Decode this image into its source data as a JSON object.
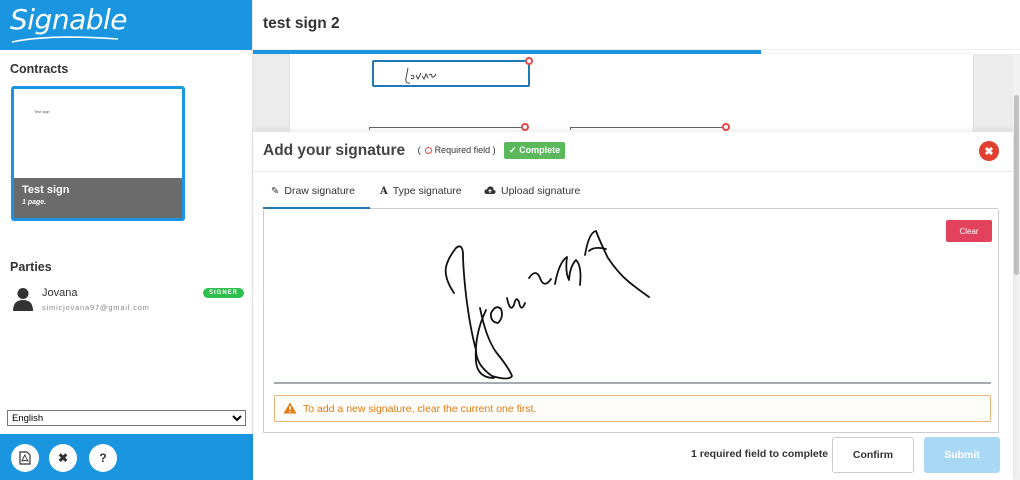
{
  "brand": {
    "name": "Signable"
  },
  "sidebar": {
    "contracts_title": "Contracts",
    "contract": {
      "thumb_text": "Test sign",
      "name": "Test sign",
      "pages": "1 page."
    },
    "parties_title": "Parties",
    "party": {
      "name": "Jovana",
      "email": "simicjovana97@gmail.com",
      "role": "SIGNER"
    },
    "language": {
      "selected": "English"
    },
    "bottom_buttons": [
      "pdf-icon",
      "close-icon",
      "help-icon"
    ]
  },
  "main": {
    "document_title": "test sign 2",
    "field_signature_text": "Jovana"
  },
  "modal": {
    "title": "Add your signature",
    "required_legend": "Required field )",
    "required_open": "(",
    "complete_label": "Complete",
    "tabs": [
      {
        "label": "Draw signature",
        "icon": "pencil-icon"
      },
      {
        "label": "Type signature",
        "icon": "type-icon"
      },
      {
        "label": "Upload signature",
        "icon": "cloud-upload-icon"
      }
    ],
    "clear_label": "Clear",
    "warning": "To add a new signature, clear the current one first.",
    "footer_status": "1 required field to complete",
    "confirm_label": "Confirm",
    "submit_label": "Submit"
  },
  "colors": {
    "brand": "#1a96e0",
    "danger": "#e0402f",
    "success": "#5cb85c",
    "warning": "#e07b12"
  }
}
